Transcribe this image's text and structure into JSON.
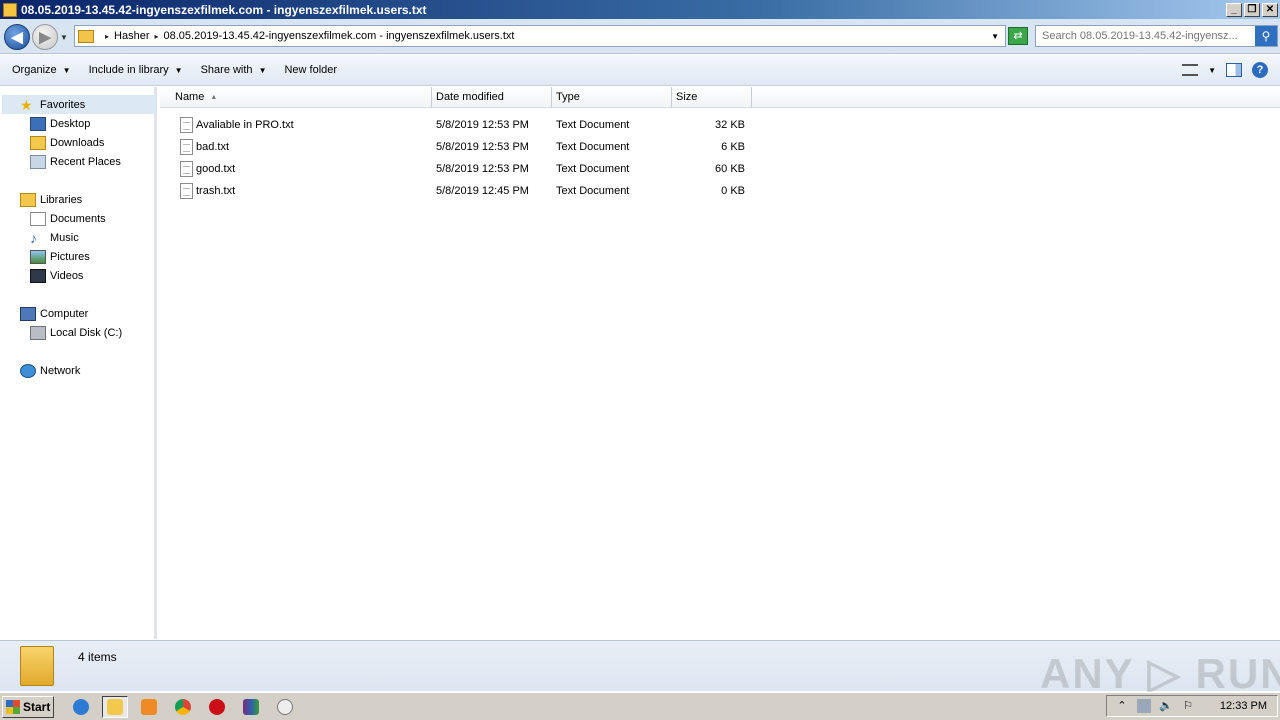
{
  "window": {
    "title": "08.05.2019-13.45.42-ingyenszexfilmek.com - ingyenszexfilmek.users.txt",
    "minimize": "_",
    "restore": "❐",
    "close": "✕"
  },
  "address": {
    "crumbs": [
      "Hasher",
      "08.05.2019-13.45.42-ingyenszexfilmek.com - ingyenszexfilmek.users.txt"
    ],
    "search_placeholder": "Search 08.05.2019-13.45.42-ingyensz..."
  },
  "toolbar": {
    "organize": "Organize",
    "include_in_library": "Include in library",
    "share_with": "Share with",
    "new_folder": "New folder"
  },
  "nav": {
    "favorites": "Favorites",
    "desktop": "Desktop",
    "downloads": "Downloads",
    "recent_places": "Recent Places",
    "libraries": "Libraries",
    "documents": "Documents",
    "music": "Music",
    "pictures": "Pictures",
    "videos": "Videos",
    "computer": "Computer",
    "local_disk": "Local Disk (C:)",
    "network": "Network"
  },
  "columns": {
    "name": "Name",
    "date_modified": "Date modified",
    "type": "Type",
    "size": "Size"
  },
  "files": [
    {
      "name": "Avaliable in PRO.txt",
      "date": "5/8/2019 12:53 PM",
      "type": "Text Document",
      "size": "32 KB"
    },
    {
      "name": "bad.txt",
      "date": "5/8/2019 12:53 PM",
      "type": "Text Document",
      "size": "6 KB"
    },
    {
      "name": "good.txt",
      "date": "5/8/2019 12:53 PM",
      "type": "Text Document",
      "size": "60 KB"
    },
    {
      "name": "trash.txt",
      "date": "5/8/2019 12:45 PM",
      "type": "Text Document",
      "size": "0 KB"
    }
  ],
  "details": {
    "item_count": "4 items",
    "watermark": "ANY.RUN"
  },
  "taskbar": {
    "start": "Start",
    "clock": "12:33 PM"
  },
  "icons": {
    "back": "back-arrow-icon",
    "forward": "forward-arrow-icon",
    "search": "search-icon",
    "help": "help-icon"
  }
}
